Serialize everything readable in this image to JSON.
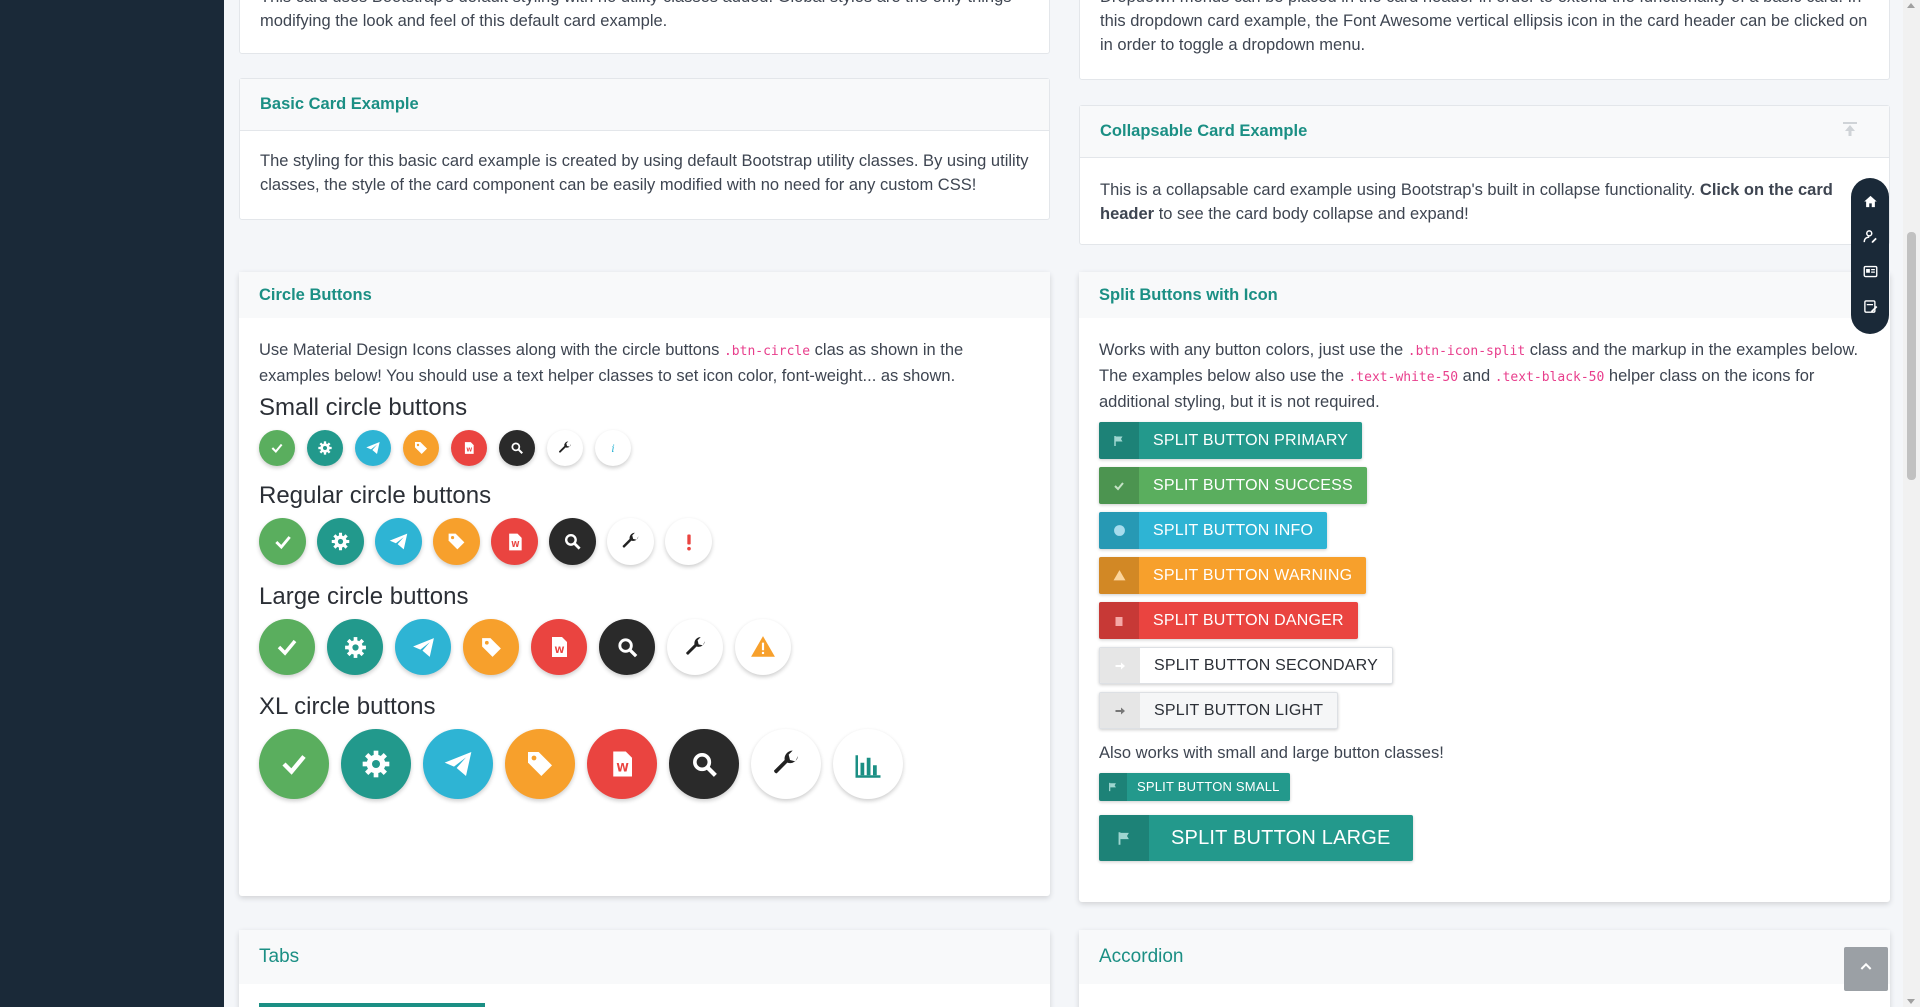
{
  "top_left_card": {
    "text": "This card uses Bootstrap's default styling with no utility classes added. Global styles are the only things modifying the look and feel of this default card example."
  },
  "top_right_card": {
    "text": "Dropdown menus can be placed in the card header in order to extend the functionality of a basic card. In this dropdown card example, the Font Awesome vertical ellipsis icon in the card header can be clicked on in order to toggle a dropdown menu."
  },
  "basic_card": {
    "title": "Basic Card Example",
    "text": "The styling for this basic card example is created by using default Bootstrap utility classes. By using utility classes, the style of the card component can be easily modified with no need for any custom CSS!"
  },
  "collapsable_card": {
    "title": "Collapsable Card Example",
    "text_pre": "This is a collapsable card example using Bootstrap's built in collapse functionality. ",
    "text_bold": "Click on the card header",
    "text_post": " to see the card body collapse and expand!"
  },
  "circle_buttons": {
    "title": "Circle Buttons",
    "desc_pre": "Use Material Design Icons classes along with the circle buttons ",
    "desc_code": ".btn-circle",
    "desc_post": " clas as shown in the examples below! You should use a text helper classes to set icon color, font-weight... as shown.",
    "small_heading": "Small circle buttons",
    "regular_heading": "Regular circle buttons",
    "large_heading": "Large circle buttons",
    "xl_heading": "XL circle buttons"
  },
  "split_buttons": {
    "title": "Split Buttons with Icon",
    "desc_1": "Works with any button colors, just use the ",
    "desc_code1": ".btn-icon-split",
    "desc_2": " class and the markup in the examples below. The examples below also use the ",
    "desc_code2": ".text-white-50",
    "desc_3": " and ",
    "desc_code3": ".text-black-50",
    "desc_4": " helper class on the icons for additional styling, but it is not required.",
    "buttons": {
      "primary": "SPLIT BUTTON PRIMARY",
      "success": "SPLIT BUTTON SUCCESS",
      "info": "SPLIT BUTTON INFO",
      "warning": "SPLIT BUTTON WARNING",
      "danger": "SPLIT BUTTON DANGER",
      "secondary": "SPLIT BUTTON SECONDARY",
      "light": "SPLIT BUTTON LIGHT"
    },
    "also_text": "Also works with small and large button classes!",
    "small": "SPLIT BUTTON SMALL",
    "large": "SPLIT BUTTON LARGE"
  },
  "tabs": {
    "title": "Tabs"
  },
  "accordion": {
    "title": "Accordion"
  },
  "colors": {
    "accent": "#1b8f84",
    "sidebar": "#1a2938"
  }
}
